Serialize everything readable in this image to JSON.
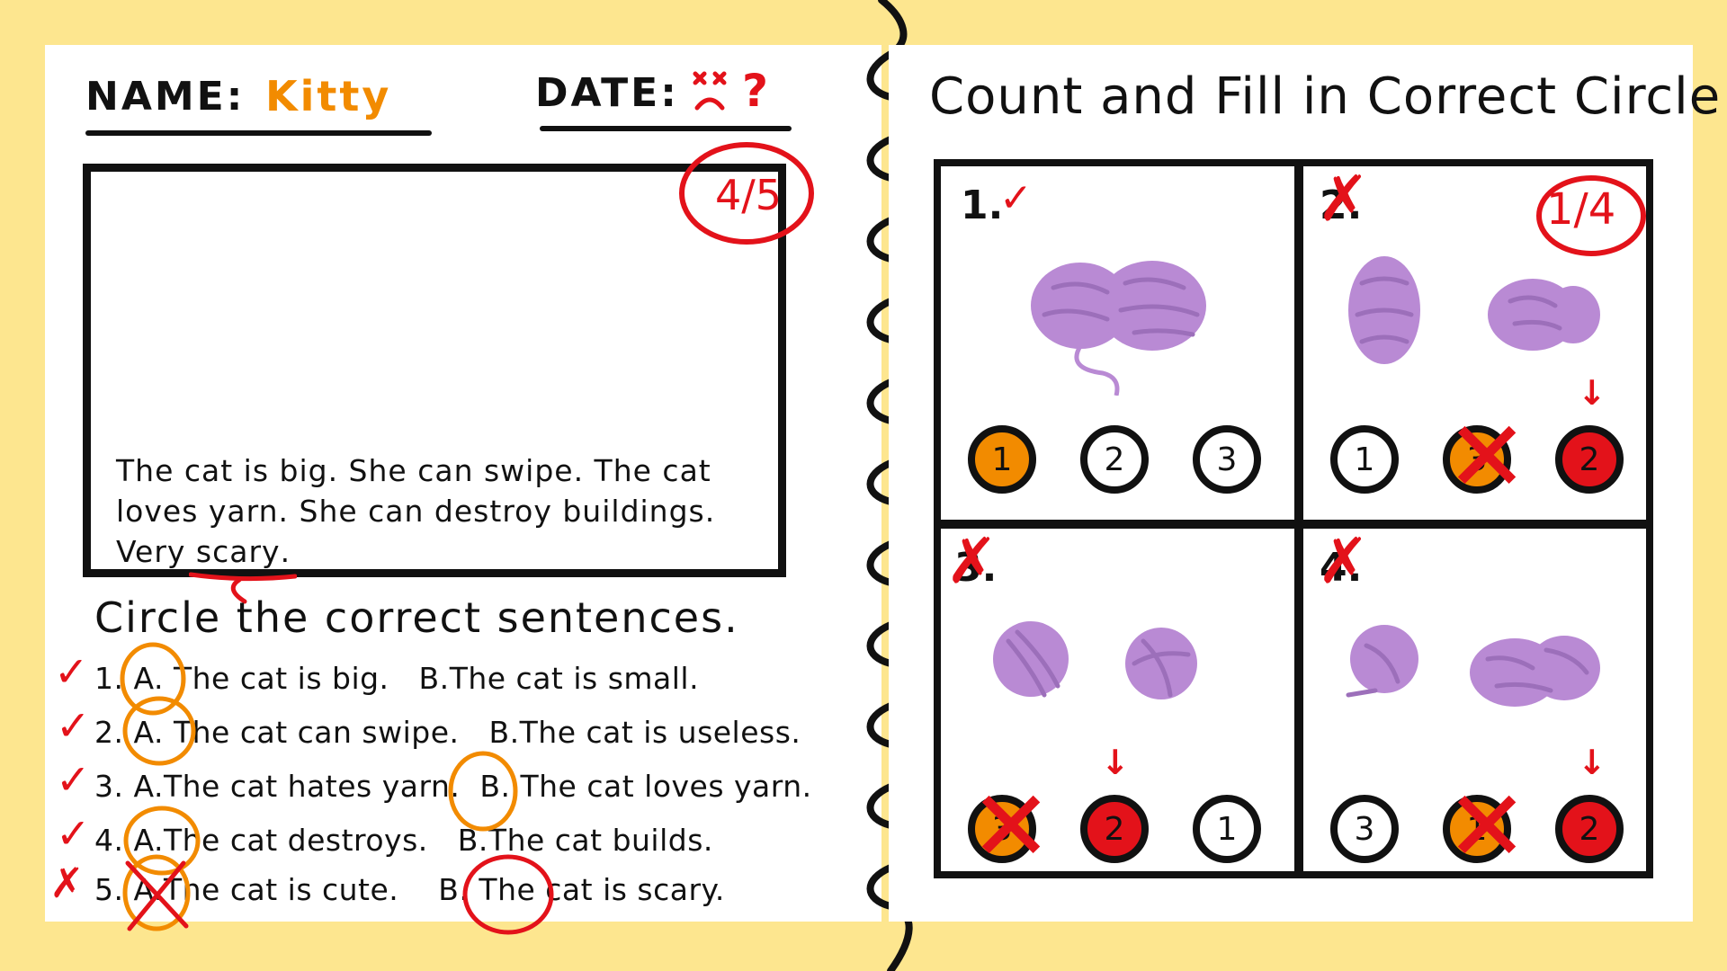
{
  "colors": {
    "background": "#fde68f",
    "paper": "#ffffff",
    "ink": "#111111",
    "correction": "#e3121a",
    "orange": "#f28b00",
    "yarn": "#b98ad4"
  },
  "header": {
    "name_label": "NAME:",
    "name_value": "Kitty",
    "date_label": "DATE:",
    "date_value": "?"
  },
  "story": {
    "score": "4/5",
    "text_part1": "The cat is big. She can swipe. The cat loves yarn. She can destroy buildings. Very ",
    "text_underlined": "scary",
    "text_end": "."
  },
  "quiz": {
    "title": "Circle the correct sentences.",
    "rows": [
      {
        "n": "1.",
        "a": "A.",
        "a_text": "The cat is big.",
        "b": "B.",
        "b_text": "The cat is small.",
        "mark": "✓"
      },
      {
        "n": "2.",
        "a": "A.",
        "a_text": "The cat can swipe.",
        "b": "B.",
        "b_text": "The cat is useless.",
        "mark": "✓"
      },
      {
        "n": "3.",
        "a": "A.",
        "a_text": "The cat hates yarn.",
        "b": "B.",
        "b_text": "The cat loves yarn.",
        "mark": "✓"
      },
      {
        "n": "4.",
        "a": "A.",
        "a_text": "The cat destroys.",
        "b": "B.",
        "b_text": "The cat builds.",
        "mark": "✓"
      },
      {
        "n": "5.",
        "a": "A.",
        "a_text": "The cat is cute.",
        "b": "B.",
        "b_text": "The cat is scary.",
        "mark": "✗"
      }
    ]
  },
  "count": {
    "title": "Count and Fill in Correct Circle",
    "score": "1/4",
    "cells": [
      {
        "label": "1.",
        "mark": "✓",
        "circles": [
          "1",
          "2",
          "3"
        ]
      },
      {
        "label": "2.",
        "mark": "✗",
        "circles": [
          "1",
          "3",
          "2"
        ]
      },
      {
        "label": "3.",
        "mark": "✗",
        "circles": [
          "3",
          "2",
          "1"
        ]
      },
      {
        "label": "4.",
        "mark": "✗",
        "circles": [
          "3",
          "1",
          "2"
        ]
      }
    ]
  },
  "icons": {
    "spiral": "spiral-binding-icon",
    "yarn": "yarn-ball-icon",
    "check": "check-icon",
    "cross": "cross-icon",
    "arrow": "down-arrow-icon"
  }
}
